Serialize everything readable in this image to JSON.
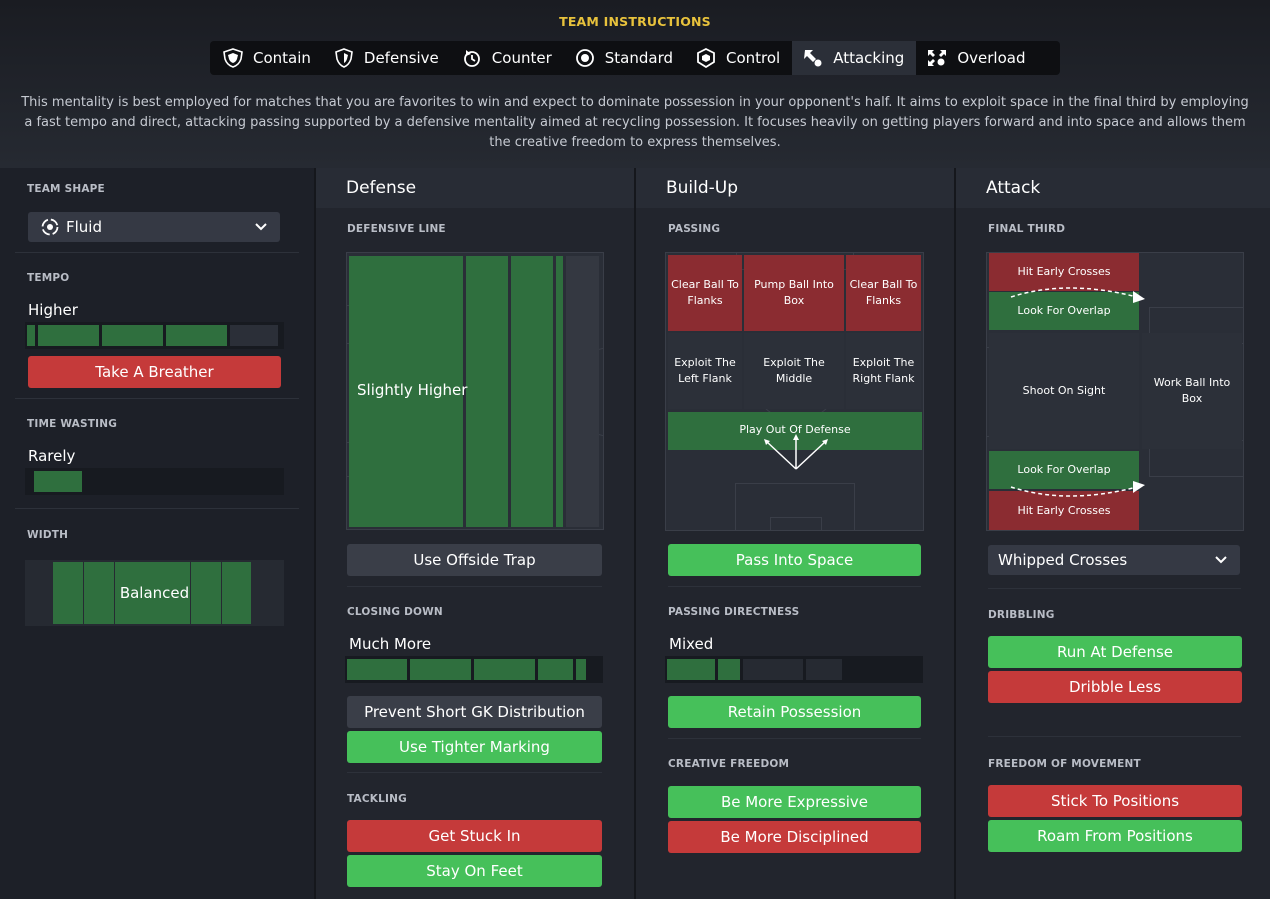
{
  "page": {
    "title": "TEAM INSTRUCTIONS"
  },
  "tabs": [
    {
      "label": "Contain",
      "icon": "shield-icon"
    },
    {
      "label": "Defensive",
      "icon": "shield-icon"
    },
    {
      "label": "Counter",
      "icon": "counter-icon"
    },
    {
      "label": "Standard",
      "icon": "target-icon"
    },
    {
      "label": "Control",
      "icon": "cube-icon"
    },
    {
      "label": "Attacking",
      "icon": "arrow-icon",
      "active": true
    },
    {
      "label": "Overload",
      "icon": "overload-icon"
    }
  ],
  "description": "This mentality is best employed for matches that you are favorites to win and expect to dominate possession in your opponent's half. It aims to exploit space in the final third by employing a fast tempo and direct, attacking passing supported by a defensive mentality aimed at recycling possession. It focuses heavily on getting players forward and into space and allows them the creative freedom to express themselves.",
  "left": {
    "team_shape": {
      "label": "TEAM SHAPE",
      "value": "Fluid"
    },
    "tempo": {
      "label": "TEMPO",
      "value": "Higher",
      "level": 0.9,
      "button": "Take A Breather"
    },
    "time_wasting": {
      "label": "TIME WASTING",
      "value": "Rarely",
      "level": 0.2
    },
    "width": {
      "label": "WIDTH",
      "value": "Balanced"
    }
  },
  "defense": {
    "title": "Defense",
    "defensive_line": {
      "label": "DEFENSIVE LINE",
      "value": "Slightly Higher"
    },
    "offside_button": "Use Offside Trap",
    "closing_down": {
      "label": "CLOSING DOWN",
      "value": "Much More",
      "level": 0.98
    },
    "prevent_gk_button": "Prevent Short GK Distribution",
    "tighter_marking_button": "Use Tighter Marking",
    "tackling": {
      "label": "TACKLING",
      "buttons": [
        "Get Stuck In",
        "Stay On Feet"
      ]
    }
  },
  "buildup": {
    "title": "Build-Up",
    "passing": {
      "label": "PASSING",
      "zones": {
        "clear_left": "Clear Ball To Flanks",
        "pump": "Pump Ball Into Box",
        "clear_right": "Clear Ball To Flanks",
        "exploit_left": "Exploit The Left Flank",
        "exploit_middle": "Exploit The Middle",
        "exploit_right": "Exploit The Right Flank",
        "play_out": "Play Out Of Defense"
      }
    },
    "pass_space_button": "Pass Into Space",
    "passing_directness": {
      "label": "PASSING DIRECTNESS",
      "value": "Mixed",
      "level": 0.3
    },
    "retain_button": "Retain Possession",
    "creative_freedom": {
      "label": "CREATIVE FREEDOM",
      "buttons": [
        "Be More Expressive",
        "Be More Disciplined"
      ]
    }
  },
  "attack": {
    "title": "Attack",
    "final_third": {
      "label": "FINAL THIRD",
      "zones": {
        "cross_top": "Hit Early Crosses",
        "overlap_top": "Look For Overlap",
        "shoot": "Shoot On Sight",
        "work_ball": "Work Ball Into Box",
        "overlap_bottom": "Look For Overlap",
        "cross_bottom": "Hit Early Crosses"
      }
    },
    "crossing": {
      "value": "Whipped Crosses"
    },
    "dribbling": {
      "label": "DRIBBLING",
      "buttons": [
        "Run At Defense",
        "Dribble Less"
      ]
    },
    "freedom": {
      "label": "FREEDOM OF MOVEMENT",
      "buttons": [
        "Stick To Positions",
        "Roam From Positions"
      ]
    }
  },
  "colors": {
    "accent": "#e8c23c",
    "green": "#46c05a",
    "red": "#c53a3a",
    "zone_green": "#2f6f3e",
    "zone_red": "#8b2c31"
  }
}
